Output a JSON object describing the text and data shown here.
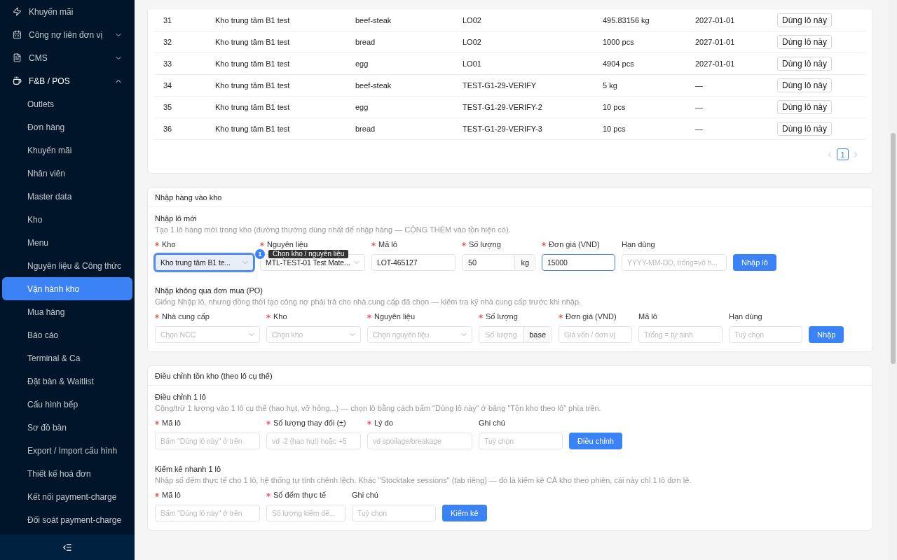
{
  "sidebar": {
    "items": [
      {
        "label": "Khuyến mãi"
      },
      {
        "label": "Công nợ liên đơn vị",
        "expanded": false
      },
      {
        "label": "CMS",
        "expanded": false
      },
      {
        "label": "F&B / POS",
        "expanded": true,
        "children": [
          {
            "label": "Outlets",
            "selected": false
          },
          {
            "label": "Đơn hàng",
            "selected": false
          },
          {
            "label": "Khuyến mãi",
            "selected": false
          },
          {
            "label": "Nhân viên",
            "selected": false
          },
          {
            "label": "Master data",
            "selected": false
          },
          {
            "label": "Kho",
            "selected": false
          },
          {
            "label": "Menu",
            "selected": false
          },
          {
            "label": "Nguyên liệu & Công thức",
            "selected": false
          },
          {
            "label": "Vận hành kho",
            "selected": true
          },
          {
            "label": "Mua hàng",
            "selected": false
          },
          {
            "label": "Báo cáo",
            "selected": false
          },
          {
            "label": "Terminal & Ca",
            "selected": false
          },
          {
            "label": "Đặt bàn & Waitlist",
            "selected": false
          },
          {
            "label": "Cấu hình bếp",
            "selected": false
          },
          {
            "label": "Sơ đồ bàn",
            "selected": false
          },
          {
            "label": "Export / Import cấu hình",
            "selected": false
          },
          {
            "label": "Thiết kế hoá đơn",
            "selected": false
          },
          {
            "label": "Kết nối payment-charge",
            "selected": false
          },
          {
            "label": "Đối soát payment-charge",
            "selected": false
          }
        ]
      }
    ]
  },
  "lot_table": {
    "rows": [
      {
        "cells": [
          "31",
          "Kho trung tâm B1 test",
          "beef-steak",
          "LO02",
          "495.83156 kg",
          "2027-01-01"
        ],
        "action": "Dùng lô này"
      },
      {
        "cells": [
          "32",
          "Kho trung tâm B1 test",
          "bread",
          "LO02",
          "1000 pcs",
          "2027-01-01"
        ],
        "action": "Dùng lô này"
      },
      {
        "cells": [
          "33",
          "Kho trung tâm B1 test",
          "egg",
          "LO01",
          "4904 pcs",
          "2027-01-01"
        ],
        "action": "Dùng lô này"
      },
      {
        "cells": [
          "34",
          "Kho trung tâm B1 test",
          "beef-steak",
          "TEST-G1-29-VERIFY",
          "5 kg",
          "—"
        ],
        "action": "Dùng lô này"
      },
      {
        "cells": [
          "35",
          "Kho trung tâm B1 test",
          "egg",
          "TEST-G1-29-VERIFY-2",
          "10 pcs",
          "—"
        ],
        "action": "Dùng lô này"
      },
      {
        "cells": [
          "36",
          "Kho trung tâm B1 test",
          "bread",
          "TEST-G1-29-VERIFY-3",
          "10 pcs",
          "—"
        ],
        "action": "Dùng lô này"
      }
    ],
    "pagination": {
      "pages": [
        {
          "label": "1",
          "selected": true
        }
      ]
    }
  },
  "cards": [
    {
      "title": "Nhập hàng vào kho",
      "sections": [
        {
          "title": "Nhập lô mới",
          "description": "Tạo 1 lô hàng mới trong kho (đường thường dùng nhất để nhập hàng — CỘNG THÊM vào tồn hiện có).",
          "fields": [
            {
              "label": "Kho",
              "required": true,
              "kind": "select",
              "value": "Kho trung tâm B1 te...",
              "focused": true
            },
            {
              "label": "Nguyên liệu",
              "required": true,
              "kind": "select",
              "value": "MTL-TEST-01 Test Mate...",
              "focused": false,
              "tooltip": {
                "badge": "1",
                "text": "Chọn kho / nguyên liệu"
              }
            },
            {
              "label": "Mã lô",
              "required": true,
              "kind": "input",
              "value": "LOT-465127",
              "focused": false
            },
            {
              "label": "Số lượng",
              "required": true,
              "kind": "unit_input",
              "value": "50",
              "unit": "kg",
              "focused": false
            },
            {
              "label": "Đơn giá (VND)",
              "required": true,
              "kind": "input",
              "value": "15000",
              "focused": true
            },
            {
              "label": "Hạn dùng",
              "required": false,
              "kind": "input",
              "placeholder": "YYYY-MM-DD, trống=vô h...",
              "focused": false
            }
          ],
          "button": "Nhập lô"
        },
        {
          "title": "Nhập không qua đơn mua (PO)",
          "description": "Giống Nhập lô, nhưng đồng thời tạo công nợ phải trả cho nhà cung cấp đã chọn — kiểm tra kỹ nhà cung cấp trước khi nhập.",
          "fields": [
            {
              "label": "Nhà cung cấp",
              "required": true,
              "kind": "select",
              "placeholder": "Chọn NCC",
              "focused": false
            },
            {
              "label": "Kho",
              "required": true,
              "kind": "select",
              "placeholder": "Chọn kho",
              "focused": false
            },
            {
              "label": "Nguyên liệu",
              "required": true,
              "kind": "select",
              "placeholder": "Chọn nguyên liệu",
              "focused": false
            },
            {
              "label": "Số lượng",
              "required": true,
              "kind": "unit_input",
              "placeholder": "Số lượng",
              "unit": "base",
              "focused": false
            },
            {
              "label": "Đơn giá (VND)",
              "required": true,
              "kind": "input",
              "placeholder": "Giá vốn / đơn vị",
              "focused": false
            },
            {
              "label": "Mã lô",
              "required": false,
              "kind": "input",
              "placeholder": "Trống = tự sinh",
              "focused": false
            },
            {
              "label": "Hạn dùng",
              "required": false,
              "kind": "input",
              "placeholder": "Tuỳ chọn",
              "focused": false
            }
          ],
          "button": "Nhập"
        }
      ]
    },
    {
      "title": "Điều chỉnh tồn kho (theo lô cụ thể)",
      "sections": [
        {
          "title": "Điều chỉnh 1 lô",
          "description": "Cộng/trừ 1 lượng vào 1 lô cụ thể (hao hụt, vỡ hỏng...) — chọn lô bằng cách bấm \"Dùng lô này\" ở bảng \"Tồn kho theo lô\" phía trên.",
          "fields": [
            {
              "label": "Mã lô",
              "required": true,
              "kind": "input",
              "placeholder": "Bấm \"Dùng lô này\" ở trên",
              "focused": false
            },
            {
              "label": "Số lượng thay đổi (±)",
              "required": true,
              "kind": "input",
              "placeholder": "vd -2 (hao hụt) hoặc +5",
              "focused": false
            },
            {
              "label": "Lý do",
              "required": true,
              "kind": "input",
              "placeholder": "vd spoilage/breakage",
              "focused": false
            },
            {
              "label": "Ghi chú",
              "required": false,
              "kind": "input",
              "placeholder": "Tuỳ chọn",
              "focused": false
            }
          ],
          "button": "Điều chỉnh"
        },
        {
          "title": "Kiểm kê nhanh 1 lô",
          "description": "Nhập số đếm thực tế cho 1 lô, hệ thống tự tính chênh lệch. Khác \"Stocktake sessions\" (tab riêng) — đó là kiểm kê CẢ kho theo phiên, cái này chỉ 1 lô đơn lẻ.",
          "fields": [
            {
              "label": "Mã lô",
              "required": true,
              "kind": "input",
              "placeholder": "Bấm \"Dùng lô này\" ở trên",
              "focused": false
            },
            {
              "label": "Số đếm thực tế",
              "required": true,
              "kind": "input",
              "placeholder": "Số lượng kiểm đế...",
              "focused": false
            },
            {
              "label": "Ghi chú",
              "required": false,
              "kind": "input",
              "placeholder": "Tuỳ chọn",
              "focused": false
            }
          ],
          "button": "Kiểm kê"
        }
      ]
    }
  ]
}
